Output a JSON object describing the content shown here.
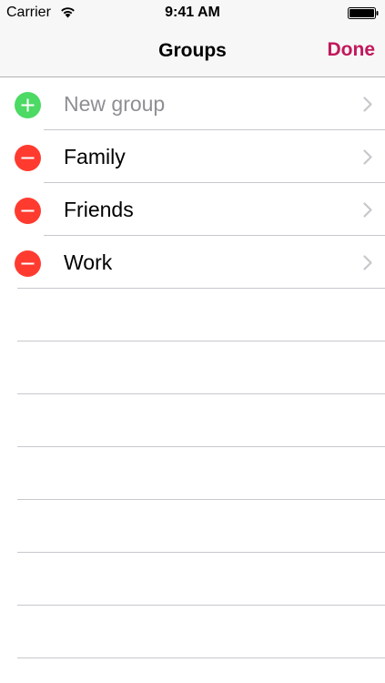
{
  "status_bar": {
    "carrier": "Carrier",
    "time": "9:41 AM",
    "icons": [
      "wifi-icon",
      "battery-icon"
    ]
  },
  "nav": {
    "title": "Groups",
    "done_label": "Done"
  },
  "colors": {
    "accent": "#c2185b",
    "add_control": "#4cd964",
    "delete_control": "#ff3b30",
    "placeholder_text": "#8e8e93",
    "separator": "#c8c7cc"
  },
  "groups": [
    {
      "label": "New group",
      "control": "add-icon",
      "placeholder": true
    },
    {
      "label": "Family",
      "control": "delete-icon",
      "placeholder": false
    },
    {
      "label": "Friends",
      "control": "delete-icon",
      "placeholder": false
    },
    {
      "label": "Work",
      "control": "delete-icon",
      "placeholder": false
    }
  ]
}
